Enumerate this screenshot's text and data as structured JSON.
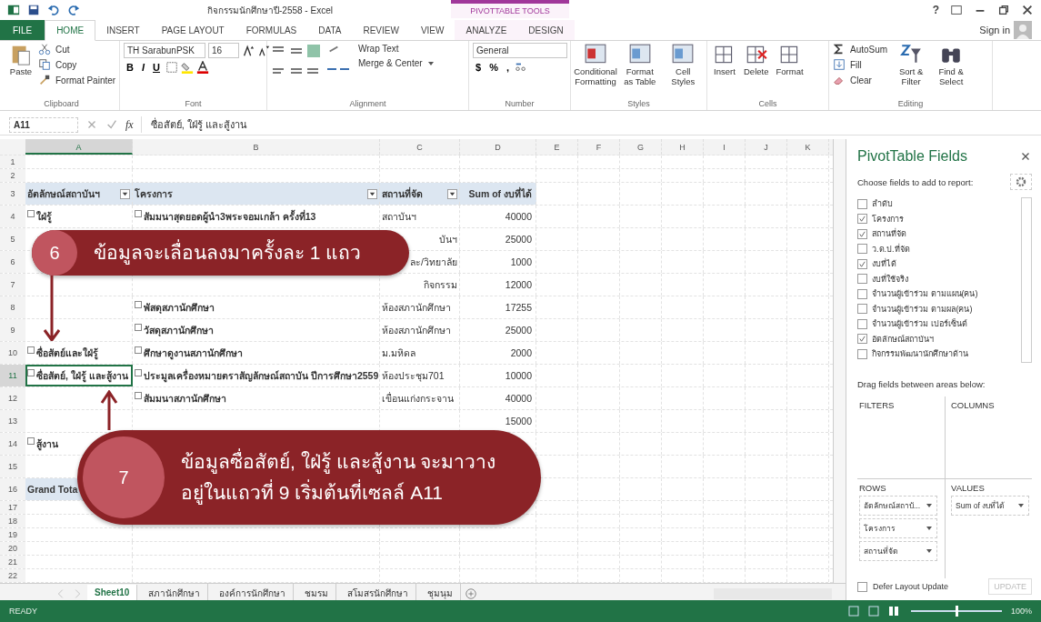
{
  "title_bar": {
    "title": "กิจกรรมนักศึกษาปี-2558 - Excel",
    "contextual_label": "PIVOTTABLE TOOLS",
    "help": "?",
    "sign_in": "Sign in"
  },
  "tabs": [
    {
      "label": "FILE",
      "kind": "file",
      "selected": false
    },
    {
      "label": "HOME",
      "kind": "normal",
      "selected": true
    },
    {
      "label": "INSERT",
      "kind": "normal",
      "selected": false
    },
    {
      "label": "PAGE LAYOUT",
      "kind": "normal",
      "selected": false
    },
    {
      "label": "FORMULAS",
      "kind": "normal",
      "selected": false
    },
    {
      "label": "DATA",
      "kind": "normal",
      "selected": false
    },
    {
      "label": "REVIEW",
      "kind": "normal",
      "selected": false
    },
    {
      "label": "VIEW",
      "kind": "normal",
      "selected": false
    },
    {
      "label": "ANALYZE",
      "kind": "contextual",
      "selected": false
    },
    {
      "label": "DESIGN",
      "kind": "contextual",
      "selected": false
    }
  ],
  "ribbon": {
    "clipboard": {
      "paste": "Paste",
      "cut": "Cut",
      "copy": "Copy",
      "format_painter": "Format Painter",
      "label": "Clipboard"
    },
    "font": {
      "font_name": "TH SarabunPSK",
      "font_size": "16",
      "style_buttons": [
        "B",
        "I",
        "U"
      ],
      "label": "Font"
    },
    "alignment": {
      "wrap_text": "Wrap Text",
      "merge": "Merge & Center",
      "label": "Alignment"
    },
    "number": {
      "format": "General",
      "symbols": [
        "$",
        "%",
        ","
      ],
      "label": "Number"
    },
    "styles": {
      "buttons": [
        "Conditional Formatting",
        "Format as Table",
        "Cell Styles"
      ],
      "label": "Styles"
    },
    "cells": {
      "buttons": [
        "Insert",
        "Delete",
        "Format"
      ],
      "label": "Cells"
    },
    "editing": {
      "autosum": "AutoSum",
      "fill": "Fill",
      "clear": "Clear",
      "sort": "Sort & Filter",
      "find": "Find & Select",
      "label": "Editing"
    }
  },
  "formula_bar": {
    "name_box": "A11",
    "function_label": "fx",
    "formula": "ซื่อสัตย์, ใฝ่รู้  และสู้งาน"
  },
  "grid": {
    "columns": [
      {
        "label": "A",
        "selected": true
      },
      {
        "label": "B",
        "selected": false
      },
      {
        "label": "C",
        "selected": false
      },
      {
        "label": "D",
        "selected": false
      },
      {
        "label": "E",
        "selected": false
      },
      {
        "label": "F",
        "selected": false
      },
      {
        "label": "G",
        "selected": false
      },
      {
        "label": "H",
        "selected": false
      },
      {
        "label": "I",
        "selected": false
      },
      {
        "label": "J",
        "selected": false
      },
      {
        "label": "K",
        "selected": false
      }
    ],
    "rows": [
      {
        "num": "1",
        "kind": "short",
        "selected": false,
        "cells": []
      },
      {
        "num": "2",
        "kind": "short",
        "selected": false,
        "cells": []
      },
      {
        "num": "3",
        "kind": "header",
        "selected": false,
        "cells": [
          {
            "text": "อัตลักษณ์สถาบันฯ",
            "filter": true
          },
          {
            "text": "โครงการ",
            "filter": true
          },
          {
            "text": "สถานที่จัด",
            "filter": true
          },
          {
            "text": "Sum of งบที่ได้",
            "filter": false
          }
        ]
      },
      {
        "num": "4",
        "kind": "data",
        "selected": false,
        "cells": [
          {
            "text": "ใฝ่รู้",
            "collapse": true
          },
          {
            "text": "สัมมนาสุดยอดผู้นำ3พระจอมเกล้า ครั้งที่13",
            "collapse": true
          },
          {
            "text": "สถาบันฯ"
          },
          {
            "text": "40000"
          }
        ]
      },
      {
        "num": "5",
        "kind": "data",
        "selected": false,
        "cells": [
          {
            "text": ""
          },
          {
            "text": ""
          },
          {
            "text": "บันฯ",
            "covered": true
          },
          {
            "text": "25000"
          }
        ]
      },
      {
        "num": "6",
        "kind": "data",
        "selected": false,
        "cells": [
          {
            "text": ""
          },
          {
            "text": ""
          },
          {
            "text": "ละ/วิทยาลัย",
            "covered": true
          },
          {
            "text": "1000"
          }
        ]
      },
      {
        "num": "7",
        "kind": "data",
        "selected": false,
        "cells": [
          {
            "text": ""
          },
          {
            "text": ""
          },
          {
            "text": "กิจกรรม",
            "covered": true
          },
          {
            "text": "12000"
          }
        ]
      },
      {
        "num": "8",
        "kind": "data",
        "selected": false,
        "cells": [
          {
            "text": ""
          },
          {
            "text": "พัสดุสภานักศึกษา",
            "collapse": true
          },
          {
            "text": "ห้องสภานักศึกษา"
          },
          {
            "text": "17255"
          }
        ]
      },
      {
        "num": "9",
        "kind": "data",
        "selected": false,
        "cells": [
          {
            "text": ""
          },
          {
            "text": "วัสดุสภานักศึกษา",
            "collapse": true
          },
          {
            "text": "ห้องสภานักศึกษา"
          },
          {
            "text": "25000"
          }
        ]
      },
      {
        "num": "10",
        "kind": "data",
        "selected": false,
        "cells": [
          {
            "text": "ซื่อสัตย์และใฝ่รู้",
            "collapse": true
          },
          {
            "text": "ศึกษาดูงานสภานักศึกษา",
            "collapse": true
          },
          {
            "text": "ม.มหิดล"
          },
          {
            "text": "2000"
          }
        ]
      },
      {
        "num": "11",
        "kind": "data",
        "selected": true,
        "cells": [
          {
            "text": "ซื่อสัตย์, ใฝ่รู้ และสู้งาน",
            "collapse": true,
            "active": true
          },
          {
            "text": "ประมูลเครื่องหมายตราสัญลักษณ์สถาบัน ปีการศึกษา2559",
            "collapse": true
          },
          {
            "text": "ห้องประชุม701"
          },
          {
            "text": "10000"
          }
        ]
      },
      {
        "num": "12",
        "kind": "data",
        "selected": false,
        "cells": [
          {
            "text": ""
          },
          {
            "text": "สัมมนาสภานักศึกษา",
            "collapse": true
          },
          {
            "text": "เขื่อนแก่งกระจาน"
          },
          {
            "text": "40000"
          }
        ]
      },
      {
        "num": "13",
        "kind": "data",
        "selected": false,
        "cells": [
          {
            "text": ""
          },
          {
            "text": ""
          },
          {
            "text": ""
          },
          {
            "text": "15000"
          }
        ]
      },
      {
        "num": "14",
        "kind": "data",
        "selected": false,
        "cells": [
          {
            "text": "สู้งาน",
            "collapse": true
          }
        ]
      },
      {
        "num": "15",
        "kind": "data",
        "selected": false,
        "cells": []
      },
      {
        "num": "16",
        "kind": "total",
        "selected": false,
        "cells": [
          {
            "text": "Grand Tota"
          }
        ]
      },
      {
        "num": "17",
        "kind": "short",
        "selected": false,
        "cells": []
      },
      {
        "num": "18",
        "kind": "short",
        "selected": false,
        "cells": []
      },
      {
        "num": "19",
        "kind": "short",
        "selected": false,
        "cells": []
      },
      {
        "num": "20",
        "kind": "short",
        "selected": false,
        "cells": []
      },
      {
        "num": "21",
        "kind": "short",
        "selected": false,
        "cells": []
      },
      {
        "num": "22",
        "kind": "short",
        "selected": false,
        "cells": []
      }
    ]
  },
  "callouts": [
    {
      "number": "6",
      "lines": [
        "ข้อมูลจะเลื่อนลงมาครั้งละ 1 แถว"
      ]
    },
    {
      "number": "7",
      "lines": [
        "ข้อมูลซื่อสัตย์, ใฝ่รู้ และสู้งาน จะมาวาง",
        "อยู่ในแถวที่ 9 เริ่มต้นที่เซลล์ A11"
      ]
    }
  ],
  "sheet_tabs": [
    {
      "label": "Sheet10",
      "selected": true
    },
    {
      "label": "สภานักศึกษา",
      "selected": false
    },
    {
      "label": "องค์การนักศึกษา",
      "selected": false
    },
    {
      "label": "ชมรม",
      "selected": false
    },
    {
      "label": "สโมสรนักศึกษา",
      "selected": false
    },
    {
      "label": "ชุมนุม",
      "selected": false
    }
  ],
  "pivot_pane": {
    "title": "PivotTable Fields",
    "subtitle": "Choose fields to add to report:",
    "fields": [
      {
        "label": "ลำดับ",
        "checked": false
      },
      {
        "label": "โครงการ",
        "checked": true
      },
      {
        "label": "สถานที่จัด",
        "checked": true
      },
      {
        "label": "ว.ด.ป.ที่จัด",
        "checked": false
      },
      {
        "label": "งบที่ได้",
        "checked": true
      },
      {
        "label": "งบที่ใช้จริง",
        "checked": false
      },
      {
        "label": "จำนวนผู้เข้าร่วม ตามแผน(คน)",
        "checked": false
      },
      {
        "label": "จำนวนผู้เข้าร่วม ตามผล(คน)",
        "checked": false
      },
      {
        "label": "จำนวนผู้เข้าร่วม เปอร์เซ็นต์",
        "checked": false
      },
      {
        "label": "อัตลักษณ์สถาบันฯ",
        "checked": true
      },
      {
        "label": "กิจกรรมพัฒนานักศึกษาด้าน",
        "checked": false
      }
    ],
    "drag_hint": "Drag fields between areas below:",
    "filters": {
      "label": "FILTERS"
    },
    "columns": {
      "label": "COLUMNS"
    },
    "rows": {
      "label": "ROWS",
      "items": [
        "อัตลักษณ์สถาบั...",
        "โครงการ",
        "สถานที่จัด"
      ]
    },
    "values": {
      "label": "VALUES",
      "items": [
        "Sum of งบที่ได้"
      ]
    },
    "defer": {
      "label": "Defer Layout Update",
      "checked": false
    },
    "update": {
      "label": "UPDATE",
      "disabled": true
    }
  },
  "status_bar": {
    "status": "READY",
    "zoom_slider": {
      "level": 0.5
    },
    "zoom": "100%"
  }
}
